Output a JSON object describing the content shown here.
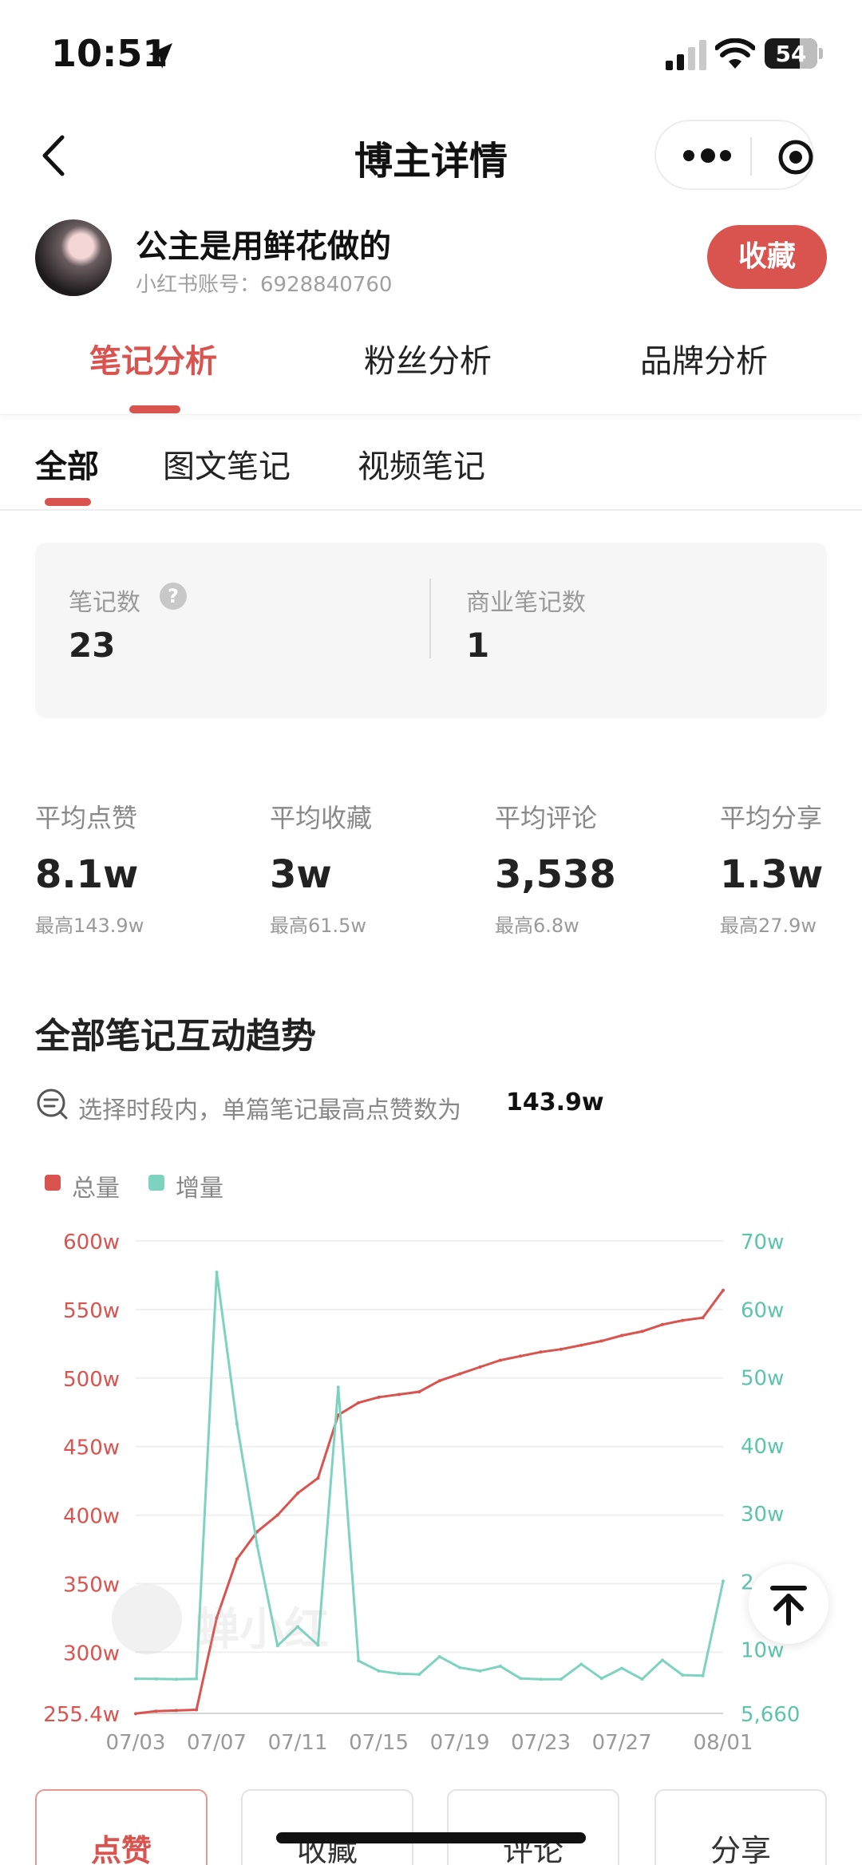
{
  "status_bar": {
    "time": "10:51",
    "battery": "54"
  },
  "nav": {
    "title": "博主详情"
  },
  "profile": {
    "name": "公主是用鲜花做的",
    "account": "小红书账号：6928840760",
    "favorite_label": "收藏"
  },
  "primary_tabs": [
    {
      "label": "笔记分析",
      "active": true
    },
    {
      "label": "粉丝分析",
      "active": false
    },
    {
      "label": "品牌分析",
      "active": false
    }
  ],
  "secondary_tabs": [
    {
      "label": "全部",
      "active": true
    },
    {
      "label": "图文笔记",
      "active": false
    },
    {
      "label": "视频笔记",
      "active": false
    }
  ],
  "stats": {
    "notes_label": "笔记数",
    "notes_value": "23",
    "help_icon": "?",
    "commercial_label": "商业笔记数",
    "commercial_value": "1"
  },
  "averages": [
    {
      "label": "平均点赞",
      "value": "8.1w",
      "max": "最高143.9w"
    },
    {
      "label": "平均收藏",
      "value": "3w",
      "max": "最高61.5w"
    },
    {
      "label": "平均评论",
      "value": "3,538",
      "max": "最高6.8w"
    },
    {
      "label": "平均分享",
      "value": "1.3w",
      "max": "最高27.9w"
    }
  ],
  "trend": {
    "title": "全部笔记互动趋势",
    "hint": "选择时段内，单篇笔记最高点赞数为",
    "hint_value": "143.9w"
  },
  "watermark": "蝉小红",
  "colors": {
    "accent": "#d9534f",
    "total": "#d9534f",
    "increment": "#7dd3c0"
  },
  "chart_data": {
    "type": "line",
    "series": [
      {
        "name": "总量",
        "axis": "left",
        "color": "#d9534f",
        "values": [
          2552000,
          2570000,
          2575000,
          2580000,
          3250000,
          3680000,
          3880000,
          4000000,
          4160000,
          4270000,
          4730000,
          4820000,
          4860000,
          4880000,
          4900000,
          4980000,
          5030000,
          5080000,
          5130000,
          5160000,
          5190000,
          5210000,
          5240000,
          5270000,
          5310000,
          5340000,
          5390000,
          5420000,
          5440000,
          5640000
        ]
      },
      {
        "name": "增量",
        "axis": "right",
        "color": "#7dd3c0",
        "values": [
          56600,
          56300,
          55800,
          56500,
          654000,
          431000,
          252000,
          105000,
          133000,
          106000,
          485000,
          83000,
          68000,
          64000,
          63000,
          89000,
          73000,
          68000,
          75000,
          57000,
          55800,
          56000,
          78000,
          57000,
          72000,
          56000,
          84000,
          62000,
          61000,
          200000
        ]
      }
    ],
    "x": [
      "07/03",
      "07/04",
      "07/05",
      "07/06",
      "07/07",
      "07/08",
      "07/09",
      "07/10",
      "07/11",
      "07/12",
      "07/13",
      "07/14",
      "07/15",
      "07/16",
      "07/17",
      "07/18",
      "07/19",
      "07/20",
      "07/21",
      "07/22",
      "07/23",
      "07/24",
      "07/25",
      "07/26",
      "07/27",
      "07/28",
      "07/29",
      "07/30",
      "07/31",
      "08/01"
    ],
    "x_ticks": [
      "07/03",
      "07/07",
      "07/11",
      "07/15",
      "07/19",
      "07/23",
      "07/27",
      "08/01"
    ],
    "y_left_ticks": [
      "255.4w",
      "300w",
      "350w",
      "400w",
      "450w",
      "500w",
      "550w",
      "600w"
    ],
    "y_left_values": [
      2554000,
      3000000,
      3500000,
      4000000,
      4500000,
      5000000,
      5500000,
      6000000
    ],
    "y_right_ticks": [
      "5,660",
      "10w",
      "2",
      "30w",
      "40w",
      "50w",
      "60w",
      "70w"
    ],
    "y_right_values": [
      5660,
      100000,
      200000,
      300000,
      400000,
      500000,
      600000,
      700000
    ],
    "ylim_left": [
      2554000,
      6000000
    ],
    "ylim_right": [
      5660,
      700000
    ],
    "grid": true,
    "legend": "top-left"
  },
  "metric_buttons": [
    {
      "label": "点赞",
      "active": true
    },
    {
      "label": "收藏",
      "active": false
    },
    {
      "label": "评论",
      "active": false
    },
    {
      "label": "分享",
      "active": false
    }
  ]
}
